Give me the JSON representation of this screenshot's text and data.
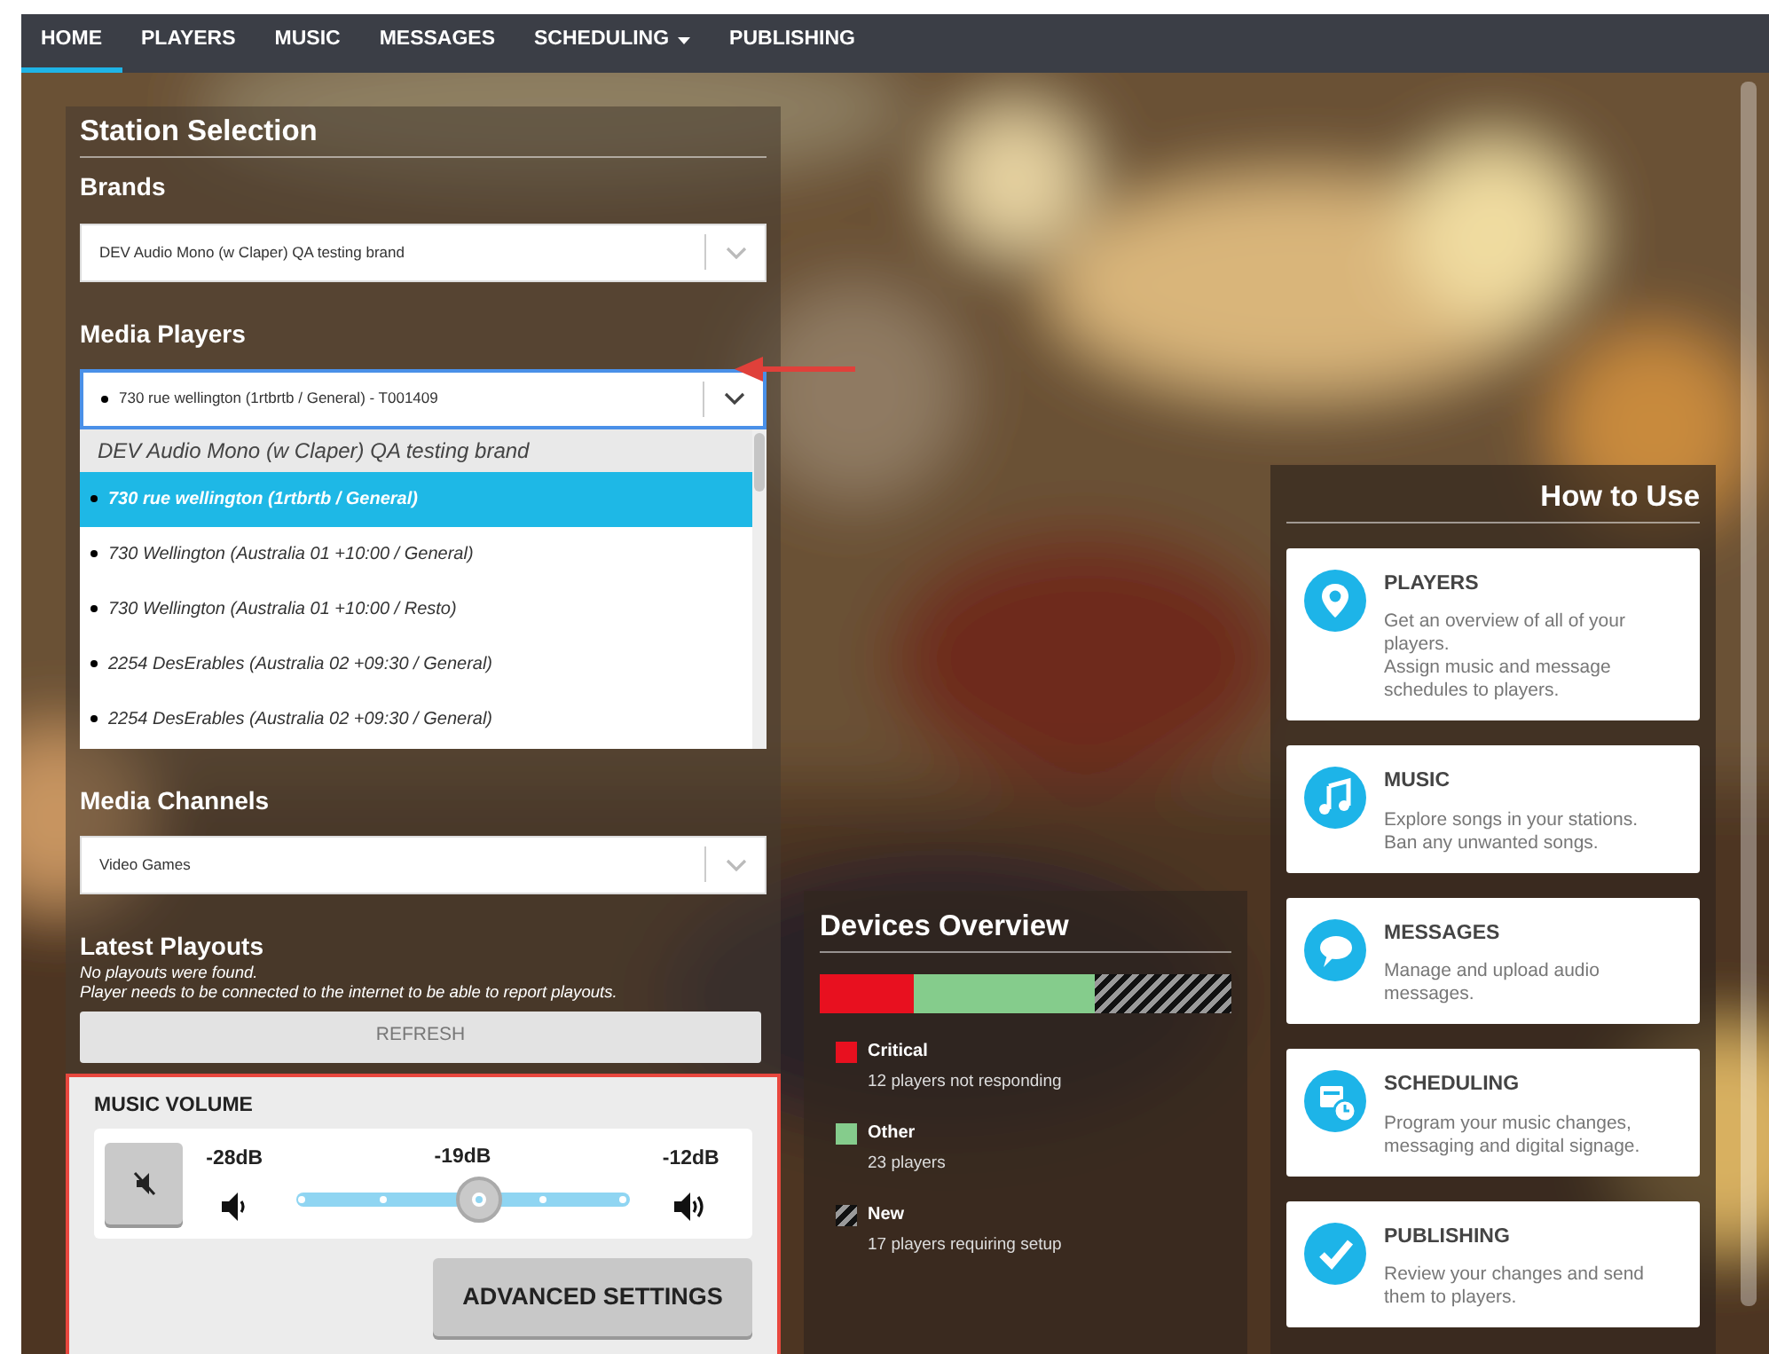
{
  "nav": [
    {
      "label": "HOME",
      "selected": true,
      "kind": "link"
    },
    {
      "label": "PLAYERS",
      "selected": false,
      "kind": "link"
    },
    {
      "label": "MUSIC",
      "selected": false,
      "kind": "link"
    },
    {
      "label": "MESSAGES",
      "selected": false,
      "kind": "link"
    },
    {
      "label": "SCHEDULING",
      "selected": false,
      "kind": "menu"
    },
    {
      "label": "PUBLISHING",
      "selected": false,
      "kind": "link"
    }
  ],
  "station_selection": {
    "title": "Station Selection",
    "brands": {
      "label": "Brands",
      "value": "DEV Audio Mono (w Claper) QA testing brand"
    },
    "media_players": {
      "label": "Media Players",
      "value": "730 rue wellington (1rtbrtb / General) - T001409",
      "expanded": true,
      "annotated": true,
      "group": "DEV Audio Mono (w Claper) QA testing brand",
      "options": [
        {
          "label": "730 rue wellington (1rtbrtb / General)",
          "selected": true
        },
        {
          "label": "730 Wellington (Australia 01 +10:00 / General)",
          "selected": false
        },
        {
          "label": "730 Wellington (Australia 01 +10:00 / Resto)",
          "selected": false
        },
        {
          "label": "2254 DesErables (Australia 02 +09:30 / General)",
          "selected": false
        },
        {
          "label": "2254 DesErables (Australia 02 +09:30 / General)",
          "selected": false
        }
      ]
    },
    "media_channels": {
      "label": "Media Channels",
      "value": "Video Games"
    },
    "latest_playouts": {
      "title": "Latest Playouts",
      "message": "No playouts were found.",
      "hint": "Player needs to be connected to the internet to be able to report playouts.",
      "button": "REFRESH"
    },
    "music_volume": {
      "title": "MUSIC VOLUME",
      "highlighted": true,
      "min_label": "-28dB",
      "current_label": "-19dB",
      "max_label": "-12dB",
      "level": 0.55,
      "button": "ADVANCED SETTINGS"
    }
  },
  "devices_overview": {
    "title": "Devices Overview",
    "segments": [
      {
        "kind": "solid",
        "color": "#e8101f",
        "level": 0.23
      },
      {
        "kind": "solid",
        "color": "#85cc8c",
        "level": 0.44
      },
      {
        "kind": "striped",
        "color": "#9a9a9a",
        "level": 0.33
      }
    ],
    "legend": [
      {
        "kind": "solid",
        "color": "#e8101f",
        "label": "Critical",
        "detail": "12 players not responding"
      },
      {
        "kind": "solid",
        "color": "#85cc8c",
        "label": "Other",
        "detail": "23 players"
      },
      {
        "kind": "striped",
        "color": "#9a9a9a",
        "label": "New",
        "detail": "17 players requiring setup"
      }
    ]
  },
  "how_to_use": {
    "title": "How to Use",
    "cards": [
      {
        "kind": "pin",
        "title": "PLAYERS",
        "lines": [
          "Get an overview of all of your players.",
          "Assign music and message schedules to players."
        ]
      },
      {
        "kind": "note",
        "title": "MUSIC",
        "lines": [
          "Explore songs in your stations.",
          "Ban any unwanted songs."
        ]
      },
      {
        "kind": "bubble",
        "title": "MESSAGES",
        "lines": [
          "Manage and upload audio messages."
        ]
      },
      {
        "kind": "calendar",
        "title": "SCHEDULING",
        "lines": [
          "Program your music changes, messaging and digital signage."
        ]
      },
      {
        "kind": "check",
        "title": "PUBLISHING",
        "lines": [
          "Review your changes and send them to players."
        ]
      }
    ]
  }
}
